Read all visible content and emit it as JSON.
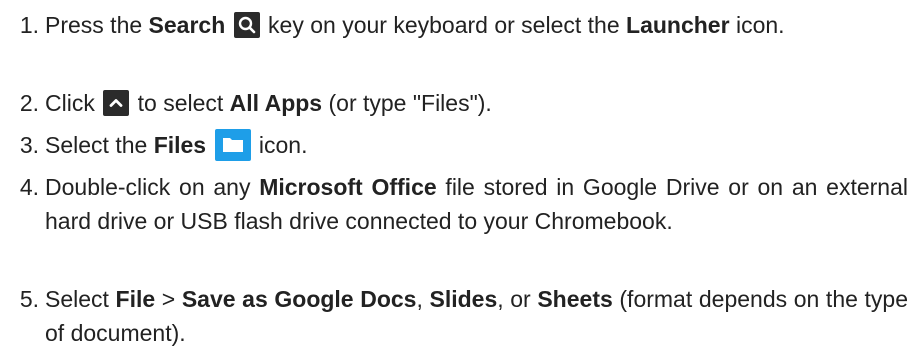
{
  "steps": [
    {
      "number": "1.",
      "parts": [
        "Press the ",
        "Search",
        " key on your keyboard or select the ",
        "Launcher",
        " icon."
      ]
    },
    {
      "number": "2.",
      "parts": [
        "Click ",
        " to select ",
        "All Apps",
        " (or type \"Files\")."
      ]
    },
    {
      "number": "3.",
      "parts": [
        "Select the ",
        "Files",
        " icon."
      ]
    },
    {
      "number": "4.",
      "parts": [
        "Double-click on any ",
        "Microsoft Office",
        " file stored in Google Drive or on an external hard drive or USB flash drive connected to your Chromebook."
      ]
    },
    {
      "number": "5.",
      "parts": [
        "Select ",
        "File",
        " > ",
        "Save as Google Docs",
        ", ",
        "Slides",
        ", or ",
        "Sheets",
        " (format depends on the type of document)."
      ]
    }
  ],
  "icons": {
    "search": "search-key-icon",
    "launcher_up": "chevron-up-icon",
    "files": "folder-icon"
  },
  "colors": {
    "text": "#222222",
    "icon_dark": "#2b2b2b",
    "files_blue": "#1e9ee8"
  }
}
